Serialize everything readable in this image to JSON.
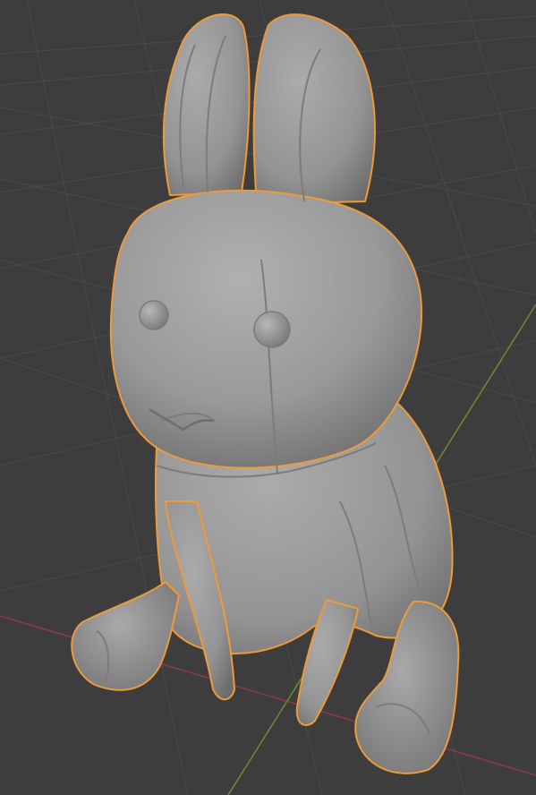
{
  "viewport": {
    "background_color": "#3d3d3d",
    "grid_color": "#4a4a4a",
    "x_axis_color": "#8e3b48",
    "y_axis_color": "#6b8c32"
  },
  "selected_object": {
    "outline_color": "#ed9a38",
    "base_color": "#8f8f8f",
    "is_selected": true
  }
}
